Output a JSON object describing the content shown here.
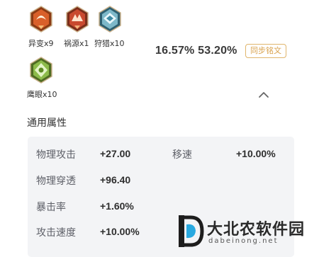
{
  "badges": [
    {
      "label": "异变x9",
      "icon": "mutation-badge-icon",
      "color": "#d9602a"
    },
    {
      "label": "祸源x1",
      "icon": "calamity-badge-icon",
      "color": "#c94a2f"
    },
    {
      "label": "狩猎x10",
      "icon": "hunt-badge-icon",
      "color": "#7db8c9"
    },
    {
      "label": "鹰眼x10",
      "icon": "hawkeye-badge-icon",
      "color": "#8dbb4a"
    }
  ],
  "stats": {
    "value1": "16.57%",
    "value2": "53.20%"
  },
  "sync_button": "同步铭文",
  "section_title": "通用属性",
  "attributes": [
    {
      "name": "物理攻击",
      "value": "+27.00"
    },
    {
      "name": "移速",
      "value": "+10.00%"
    },
    {
      "name": "物理穿透",
      "value": "+96.40"
    },
    {
      "name": "暴击率",
      "value": "+1.60%"
    },
    {
      "name": "攻击速度",
      "value": "+10.00%"
    }
  ],
  "watermark": {
    "name": "大北农软件园",
    "url": "dabeinong.net"
  }
}
